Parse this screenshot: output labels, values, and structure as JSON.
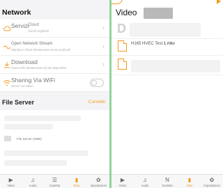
{
  "colors": {
    "accent": "#f19b1b",
    "divider": "#8fd49c"
  },
  "left": {
    "title": "Network",
    "items": [
      {
        "title": "Servizi Cloud",
        "title_a": "Servizi",
        "title_b": "Cloud",
        "subtitle": "Servizi registrati",
        "icon": "cloud-icon",
        "control": "chevron"
      },
      {
        "title": "Open Network Stream",
        "subtitle": "Riproduci i flussi direttamente senza scaricarli",
        "icon": "network-stream-icon",
        "control": "chevron"
      },
      {
        "title": "Download",
        "subtitle": "Scarica file direttamente sul tuo dispositivo",
        "icon": "download-icon",
        "control": "chevron"
      },
      {
        "title": "Sharing Via WiFi",
        "subtitle": "Server non attivo",
        "icon": "wifi-icon",
        "control": "toggle",
        "toggle_on": false
      }
    ],
    "file_server": {
      "title": "File Server",
      "connect_label": "Connetti",
      "entry_label": "File Server (SMB)"
    }
  },
  "right": {
    "title": "Video",
    "big_letter": "D",
    "files": [
      {
        "name_main": "H165 HVEC Test ",
        "name_ext": "1.mkv"
      }
    ]
  },
  "tabs": [
    {
      "label": "Video",
      "icon": "video-icon",
      "glyph": "▶"
    },
    {
      "label": "Audio",
      "icon": "audio-icon",
      "glyph": "♫"
    },
    {
      "label": "Scaletta",
      "icon": "playlist-icon",
      "glyph": "☰"
    },
    {
      "label": "Rete",
      "icon": "network-icon",
      "glyph": "▮",
      "active": true
    },
    {
      "label": "Impostazioni",
      "icon": "settings-icon",
      "glyph": "✿"
    }
  ],
  "right_tabs_glyph_overrides": {
    "2": "N"
  }
}
